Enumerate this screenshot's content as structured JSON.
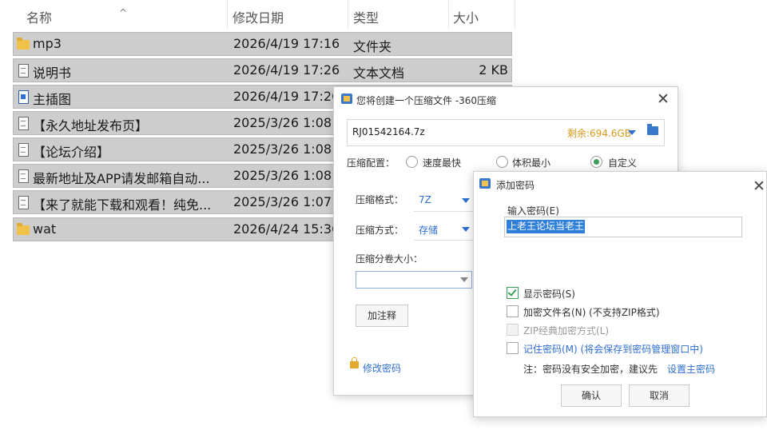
{
  "explorer": {
    "columns": {
      "name": "名称",
      "date": "修改日期",
      "type": "类型",
      "size": "大小"
    },
    "sort_indicator": "^",
    "rows": [
      {
        "icon": "folder-icon",
        "name": "mp3",
        "date": "2026/4/19 17:16",
        "type": "文件夹",
        "size": ""
      },
      {
        "icon": "document-icon",
        "name": "说明书",
        "date": "2026/4/19 17:26",
        "type": "文本文档",
        "size": "2 KB"
      },
      {
        "icon": "image-file-icon",
        "name": "主插图",
        "date": "2026/4/19 17:26",
        "type": "",
        "size": ""
      },
      {
        "icon": "document-icon",
        "name": "【永久地址发布页】",
        "date": "2025/3/26 1:08",
        "type": "",
        "size": ""
      },
      {
        "icon": "document-icon",
        "name": "【论坛介绍】",
        "date": "2025/3/26 1:08",
        "type": "",
        "size": ""
      },
      {
        "icon": "document-icon",
        "name": "最新地址及APP请发邮箱自动...",
        "date": "2025/3/26 1:08",
        "type": "",
        "size": ""
      },
      {
        "icon": "document-icon",
        "name": "【来了就能下载和观看！纯免...",
        "date": "2025/3/26 1:07",
        "type": "",
        "size": ""
      },
      {
        "icon": "folder-icon",
        "name": "wat",
        "date": "2026/4/24 15:36",
        "type": "",
        "size": ""
      }
    ]
  },
  "compress_dialog": {
    "title": "您将创建一个压缩文件 -360压缩",
    "close_glyph": "✕",
    "archive_name": "RJ01542164.7z",
    "free_space": "剩余:694.6GB",
    "config_label": "压缩配置：",
    "options": [
      {
        "label": "速度最快",
        "selected": false
      },
      {
        "label": "体积最小",
        "selected": false
      },
      {
        "label": "自定义",
        "selected": true
      }
    ],
    "format_label": "压缩格式：",
    "format_value": "7Z",
    "method_label": "压缩方式：",
    "method_value": "存储",
    "volume_label": "压缩分卷大小：",
    "volume_value": "",
    "comment_button": "加注释",
    "change_password_link": "修改密码"
  },
  "password_dialog": {
    "title": "添加密码",
    "close_glyph": "✕",
    "input_label": "输入密码(E)",
    "password_value": "上老王论坛当老王",
    "checkboxes": [
      {
        "label": "显示密码(S)",
        "checked": true,
        "disabled": false,
        "link": false
      },
      {
        "label": "加密文件名(N) (不支持ZIP格式)",
        "checked": false,
        "disabled": false,
        "link": false
      },
      {
        "label": "ZIP经典加密方式(L)",
        "checked": false,
        "disabled": true,
        "link": false
      },
      {
        "label": "记住密码(M) (将会保存到密码管理窗口中)",
        "checked": false,
        "disabled": false,
        "link": true
      }
    ],
    "note_text": "注：密码没有安全加密，建议先",
    "note_link": "设置主密码",
    "ok_button": "确认",
    "cancel_button": "取消"
  },
  "colors": {
    "accent": "#2f6fd1",
    "free_space": "#d79a1c",
    "selected_row": "#cdcdcd",
    "check_green": "#3aa05a"
  }
}
